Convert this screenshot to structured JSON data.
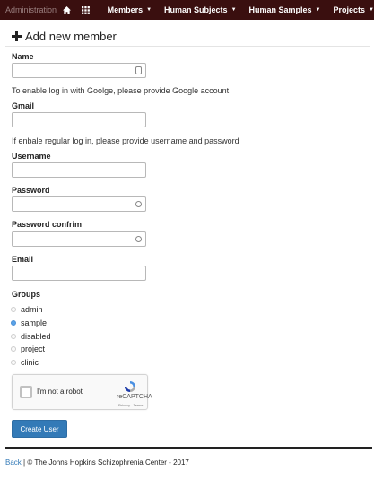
{
  "navbar": {
    "brand": "Administration",
    "home_icon": "home-icon",
    "grid_icon": "grid-icon",
    "menus": [
      {
        "label": "Members"
      },
      {
        "label": "Human Subjects"
      },
      {
        "label": "Human Samples"
      },
      {
        "label": "Projects"
      }
    ],
    "background": "#3a0f0f"
  },
  "page": {
    "title": "Add new member"
  },
  "form": {
    "name_label": "Name",
    "google_help": "To enable log in with Goolge, please provide Google account",
    "gmail_label": "Gmail",
    "regular_help": "If enbale regular log in, please provide username and password",
    "username_label": "Username",
    "password_label": "Password",
    "password_confirm_label": "Password confrim",
    "email_label": "Email",
    "groups_label": "Groups",
    "groups": [
      {
        "label": "admin",
        "checked": false
      },
      {
        "label": "sample",
        "checked": true
      },
      {
        "label": "disabled",
        "checked": false
      },
      {
        "label": "project",
        "checked": false
      },
      {
        "label": "clinic",
        "checked": false
      }
    ],
    "submit_label": "Create User"
  },
  "recaptcha": {
    "checkbox_label": "I'm not a robot",
    "brand": "reCAPTCHA",
    "terms": "Privacy - Terms"
  },
  "footer": {
    "back_link": "Back",
    "separator": "|",
    "copyright": "© The Johns Hopkins Schizophrenia Center - 2017"
  },
  "colors": {
    "primary_button": "#337ab7",
    "checked_radio": "#5aa3e8"
  }
}
